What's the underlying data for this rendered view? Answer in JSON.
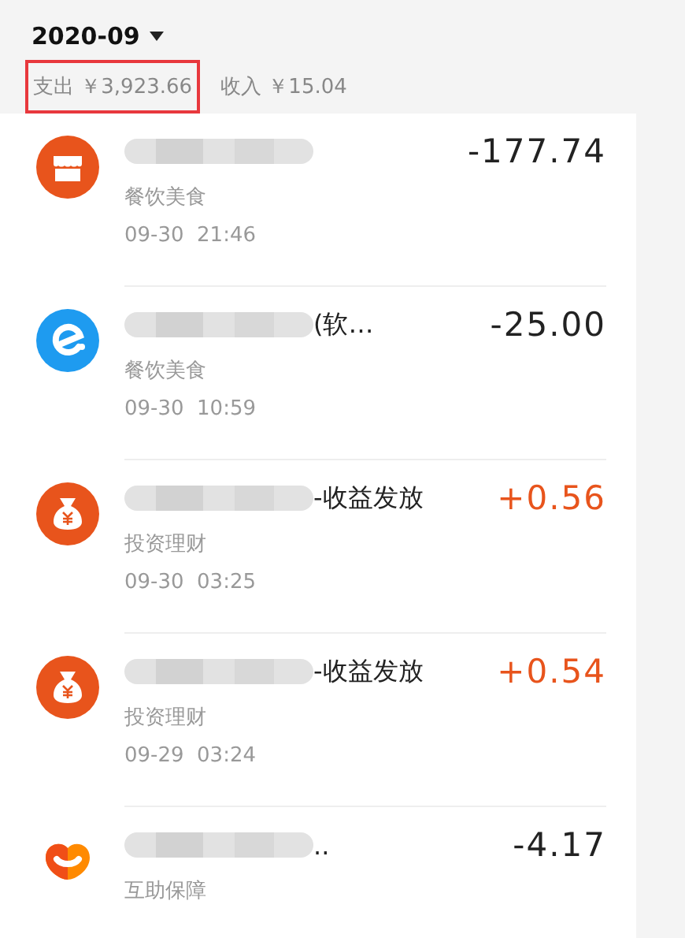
{
  "header": {
    "month": "2020-09",
    "expense": {
      "label": "支出",
      "amount": "￥3,923.66",
      "highlighted": true
    },
    "income": {
      "label": "收入",
      "amount": "￥15.04",
      "highlighted": false
    }
  },
  "transactions": [
    {
      "kind": "shop",
      "category": "餐饮美食",
      "time": "09-30  21:46",
      "amount": "-177.74",
      "income": false
    },
    {
      "kind": "e",
      "title_visible": "(软…",
      "category": "餐饮美食",
      "time": "09-30  10:59",
      "amount": "-25.00",
      "income": false
    },
    {
      "kind": "moneybag",
      "title_visible": "-收益发放",
      "category": "投资理财",
      "time": "09-30  03:25",
      "amount": "+0.56",
      "income": true
    },
    {
      "kind": "moneybag",
      "title_visible": "-收益发放",
      "category": "投资理财",
      "time": "09-29  03:24",
      "amount": "+0.54",
      "income": true
    },
    {
      "kind": "heart",
      "title_visible": "..",
      "category": "互助保障",
      "amount": "-4.17",
      "income": false
    }
  ]
}
